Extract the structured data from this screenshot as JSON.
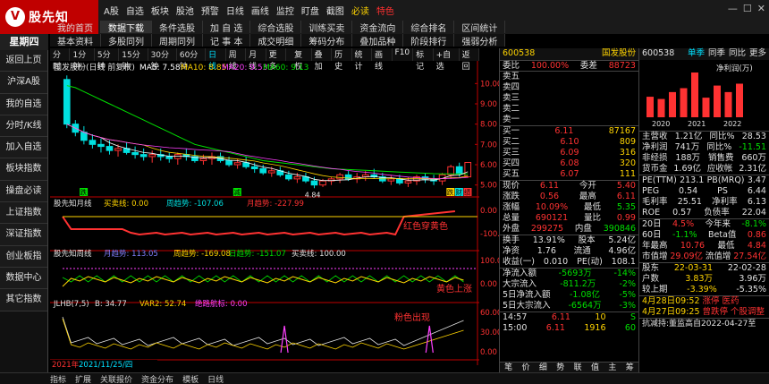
{
  "app": {
    "logo_text": "股先知",
    "logo_mark": "V",
    "top_menu": [
      "A股",
      "自选",
      "板块",
      "股池",
      "预警",
      "日线",
      "画线",
      "监控",
      "盯盘",
      "截图",
      "必读",
      "特色"
    ],
    "win_controls": [
      "—",
      "☐",
      "✕"
    ],
    "weekday": "星期四"
  },
  "tabs_row1": [
    "我的首页",
    "数据下载",
    "条件选股",
    "加 自 选",
    "综合选股",
    "训练买卖",
    "资金流向",
    "综合排名",
    "区间统计"
  ],
  "tabs_row2": [
    "基本资料",
    "多股同列",
    "周期同列",
    "记 事 本",
    "成交明细",
    "筹码分布",
    "叠加品种",
    "阶段排行",
    "强弱分析"
  ],
  "sidebar": [
    "返回上页",
    "沪深A股",
    "我的自选",
    "分时/K线",
    "加入自选",
    "板块指数",
    "操盘必读",
    "上证指数",
    "深证指数",
    "创业板指",
    "数据中心",
    "其它指数"
  ],
  "chart_toolbar": {
    "periods": [
      "分时",
      "1分钟",
      "5分钟",
      "15分钟",
      "30分钟",
      "60分钟",
      "日线",
      "周线",
      "月线",
      "更多"
    ],
    "tools": [
      "复权",
      "叠加",
      "历史",
      "统计",
      "画线",
      "F10",
      "标记",
      "+自选",
      "返回"
    ]
  },
  "main_chart": {
    "header": "国发股份(日线 前复权)",
    "ma_labels": [
      {
        "text": "MA5: 7.58",
        "color": "#ffffff"
      },
      {
        "text": "MA10: 8.85",
        "color": "#ffd400"
      },
      {
        "text": "MA20: 9.53",
        "color": "#ff40ff"
      },
      {
        "text": "MA60: 9.13",
        "color": "#00e000"
      }
    ],
    "y_ticks": [
      "10.00",
      "9.00",
      "8.00",
      "7.00",
      "6.00",
      "5.00"
    ],
    "low_label": "4.84",
    "markers": [
      "跌",
      "减",
      "跌",
      "财",
      "绩"
    ]
  },
  "indicator1": {
    "name": "股先知月线",
    "buy_label": "买卖线: 0.00",
    "trend_label": "周趋势: -107.06",
    "month_label": "月趋势: -227.99",
    "y_ticks": [
      "0.00",
      "-100.00"
    ],
    "annotation": "红色穿黄色"
  },
  "indicator2": {
    "name": "股先知周线",
    "month_label": "月趋势: 113.05",
    "week_label": "周趋势: -169.08",
    "day_label": "日趋势: -151.07",
    "buy_label": "买卖线: 100.00",
    "y_ticks": [
      "100.00",
      "0.00"
    ],
    "annotation": "黄色上涨"
  },
  "indicator3": {
    "name": "JLHB(7,5)",
    "b_label": "B: 34.77",
    "var2_label": "VAR2: 52.74",
    "absolute_label": "绝路航标: 0.00",
    "y_ticks": [
      "60.00",
      "30.00",
      "0.00"
    ],
    "annotation": "粉色出现"
  },
  "chart_footer": {
    "year": "2021年",
    "date": "2021/11/25/四",
    "tabs": [
      "指标",
      "扩展",
      "关联报价",
      "资金分布"
    ],
    "template": "模板",
    "period_tab": "日线"
  },
  "quote": {
    "code": "600538",
    "name": "国发股份",
    "weibi_label": "委比",
    "weibi": "100.00%",
    "weicha_label": "委差",
    "weicha": "88723",
    "sell": [
      {
        "label": "卖五",
        "price": "",
        "vol": ""
      },
      {
        "label": "卖四",
        "price": "",
        "vol": ""
      },
      {
        "label": "卖三",
        "price": "",
        "vol": ""
      },
      {
        "label": "卖二",
        "price": "",
        "vol": ""
      },
      {
        "label": "卖一",
        "price": "",
        "vol": ""
      }
    ],
    "buy": [
      {
        "label": "买一",
        "price": "6.11",
        "vol": "87167"
      },
      {
        "label": "买二",
        "price": "6.10",
        "vol": "809"
      },
      {
        "label": "买三",
        "price": "6.09",
        "vol": "316"
      },
      {
        "label": "买四",
        "price": "6.08",
        "vol": "320"
      },
      {
        "label": "买五",
        "price": "6.07",
        "vol": "111"
      }
    ],
    "stats": [
      {
        "l1": "现价",
        "v1": "6.11",
        "l2": "今开",
        "v2": "5.40"
      },
      {
        "l1": "涨跌",
        "v1": "0.56",
        "l2": "最高",
        "v2": "6.11"
      },
      {
        "l1": "涨幅",
        "v1": "10.09%",
        "l2": "最低",
        "v2": "5.35"
      },
      {
        "l1": "总量",
        "v1": "690121",
        "l2": "量比",
        "v2": "0.99"
      },
      {
        "l1": "外盘",
        "v1": "299275",
        "l2": "内盘",
        "v2": "390846"
      }
    ],
    "stats2": [
      {
        "l1": "换手",
        "v1": "13.91%",
        "l2": "股本",
        "v2": "5.24亿"
      },
      {
        "l1": "净资",
        "v1": "1.76",
        "l2": "流通",
        "v2": "4.96亿"
      },
      {
        "l1": "收益(一)",
        "v1": "0.010",
        "l2": "PE(动)",
        "v2": "108.1"
      }
    ],
    "flows": [
      {
        "l": "净流入额",
        "v": "-5693万",
        "p": "-14%"
      },
      {
        "l": "大宗流入",
        "v": "-811.2万",
        "p": "-2%"
      },
      {
        "l": "5日净流入额",
        "v": "-1.08亿",
        "p": "-5%"
      },
      {
        "l": "5日大宗流入",
        "v": "-6564万",
        "p": "-3%"
      }
    ],
    "ticks": [
      {
        "t": "14:57",
        "p": "6.11",
        "v": "10",
        "s": "S"
      },
      {
        "t": "15:00",
        "p": "6.11",
        "v": "1916",
        "s": "60"
      }
    ],
    "bottom_tabs": [
      "笔",
      "价",
      "细",
      "势",
      "联",
      "值",
      "主",
      "筹"
    ]
  },
  "finance": {
    "code": "600538",
    "tabs": [
      "单季",
      "同季",
      "同比",
      "更多"
    ],
    "chart_title": "净利润(万)",
    "years": [
      "2020",
      "2021",
      "2022"
    ],
    "quarter_profit": [
      1100,
      980,
      1350,
      1560,
      2400,
      1050,
      1700,
      1350,
      1800
    ],
    "rows": [
      {
        "l1": "主营收",
        "v1": "1.21亿",
        "l2": "同比%",
        "v2": "28.53"
      },
      {
        "l1": "净利润",
        "v1": "741万",
        "l2": "同比%",
        "v2": "-11.51"
      },
      {
        "l1": "非经损",
        "v1": "188万",
        "l2": "销售费",
        "v2": "660万"
      },
      {
        "l1": "货币金",
        "v1": "1.69亿",
        "l2": "应收帐",
        "v2": "2.31亿"
      }
    ],
    "rows2": [
      {
        "l1": "PE(TTM)",
        "v1": "213.1",
        "l2": "PB(MRQ)",
        "v2": "3.47"
      },
      {
        "l1": "PEG",
        "v1": "0.54",
        "l2": "PS",
        "v2": "6.44"
      },
      {
        "l1": "毛利率",
        "v1": "25.51",
        "l2": "净利率",
        "v2": "6.13"
      },
      {
        "l1": "ROE",
        "v1": "0.57",
        "l2": "负债率",
        "v2": "22.04"
      }
    ],
    "rows3": [
      {
        "l1": "20日",
        "v1": "4.5%",
        "l2": "今年来",
        "v2": "-8.1%"
      },
      {
        "l1": "60日",
        "v1": "-1.1%",
        "l2": "Beta值",
        "v2": "0.86"
      },
      {
        "l1": "年最高",
        "v1": "10.76",
        "l2": "最低",
        "v2": "4.84"
      },
      {
        "l1": "市值增",
        "v1": "29.09亿",
        "l2": "流值增",
        "v2": "27.54亿"
      }
    ],
    "holders": [
      {
        "l": "股东",
        "a": "22-03-31",
        "b": "22-02-28"
      },
      {
        "l": "户数",
        "a": "3.83万",
        "b": "3.96万"
      },
      {
        "l": "较上期",
        "a": "-3.39%",
        "b": "-5.35%"
      }
    ],
    "news": [
      {
        "date": "4月28日09:52",
        "text": "涨停 医药"
      },
      {
        "date": "4月27日09:25",
        "text": "曾跌停 个股调整"
      }
    ],
    "footer": "抗减持:董监高自2022-04-27至"
  },
  "chart_data": {
    "type": "candlestick",
    "y_range": [
      4.5,
      10.5
    ],
    "ohlc": [
      [
        10.2,
        10.4,
        7.8,
        8.0
      ],
      [
        8.0,
        8.2,
        7.4,
        7.6
      ],
      [
        7.6,
        7.9,
        7.0,
        7.2
      ],
      [
        7.2,
        7.5,
        6.8,
        7.0
      ],
      [
        7.0,
        7.3,
        6.6,
        6.9
      ],
      [
        6.9,
        7.2,
        6.5,
        6.7
      ],
      [
        6.7,
        7.0,
        6.4,
        6.8
      ],
      [
        6.8,
        7.1,
        6.5,
        6.6
      ],
      [
        6.6,
        6.9,
        6.3,
        6.5
      ],
      [
        6.5,
        6.8,
        6.2,
        6.4
      ],
      [
        6.4,
        6.7,
        6.1,
        6.5
      ],
      [
        6.5,
        6.8,
        6.2,
        6.4
      ],
      [
        6.4,
        6.6,
        6.1,
        6.3
      ],
      [
        6.3,
        6.6,
        6.0,
        6.5
      ],
      [
        6.5,
        6.8,
        6.2,
        6.4
      ],
      [
        6.4,
        6.7,
        6.1,
        6.2
      ],
      [
        6.2,
        6.5,
        6.0,
        6.3
      ],
      [
        6.3,
        6.6,
        6.0,
        6.4
      ],
      [
        6.4,
        6.6,
        6.1,
        6.2
      ],
      [
        6.2,
        6.4,
        5.9,
        6.0
      ],
      [
        6.0,
        6.3,
        5.8,
        6.1
      ],
      [
        6.1,
        6.4,
        5.8,
        5.9
      ],
      [
        5.9,
        6.1,
        5.6,
        5.8
      ],
      [
        5.8,
        6.0,
        5.5,
        5.6
      ],
      [
        5.6,
        5.9,
        5.4,
        5.7
      ],
      [
        5.7,
        5.9,
        5.4,
        5.5
      ],
      [
        5.5,
        5.7,
        5.2,
        5.3
      ],
      [
        5.3,
        5.6,
        5.1,
        5.4
      ],
      [
        5.4,
        5.6,
        5.1,
        5.2
      ],
      [
        5.2,
        5.4,
        4.84,
        5.0
      ],
      [
        5.0,
        5.3,
        4.9,
        5.2
      ],
      [
        5.2,
        5.4,
        5.0,
        5.3
      ],
      [
        5.3,
        5.6,
        5.1,
        5.5
      ],
      [
        5.5,
        5.7,
        5.2,
        5.3
      ],
      [
        5.3,
        5.6,
        5.1,
        5.4
      ],
      [
        5.4,
        5.7,
        5.2,
        5.5
      ],
      [
        5.5,
        5.8,
        5.3,
        5.4
      ],
      [
        5.4,
        5.6,
        5.1,
        5.2
      ],
      [
        5.2,
        5.5,
        5.0,
        5.3
      ],
      [
        5.3,
        5.5,
        5.0,
        5.1
      ],
      [
        5.1,
        5.4,
        4.9,
        5.2
      ],
      [
        5.2,
        5.5,
        5.0,
        5.4
      ],
      [
        5.4,
        5.6,
        5.1,
        5.3
      ],
      [
        5.3,
        5.5,
        5.0,
        5.2
      ],
      [
        5.2,
        5.6,
        5.0,
        5.5
      ],
      [
        5.5,
        6.0,
        5.3,
        5.9
      ],
      [
        5.9,
        6.1,
        5.4,
        5.55
      ],
      [
        5.4,
        6.11,
        5.35,
        6.11
      ]
    ],
    "ma60": [
      9.9,
      9.8,
      9.6,
      9.4,
      9.2,
      9.0,
      8.8,
      8.6,
      8.4,
      8.2,
      8.0,
      7.8,
      7.6,
      7.4,
      7.2,
      7.0,
      6.9,
      6.8,
      6.7,
      6.6,
      6.5,
      6.4,
      6.3,
      6.2,
      6.15,
      6.1,
      6.05,
      6.0,
      5.95,
      5.9,
      5.85,
      5.8,
      5.78,
      5.76,
      5.74,
      5.72,
      5.7,
      5.68,
      5.66,
      5.64,
      5.62,
      5.6,
      5.58,
      5.56,
      5.55,
      5.55,
      5.55,
      5.55
    ]
  }
}
